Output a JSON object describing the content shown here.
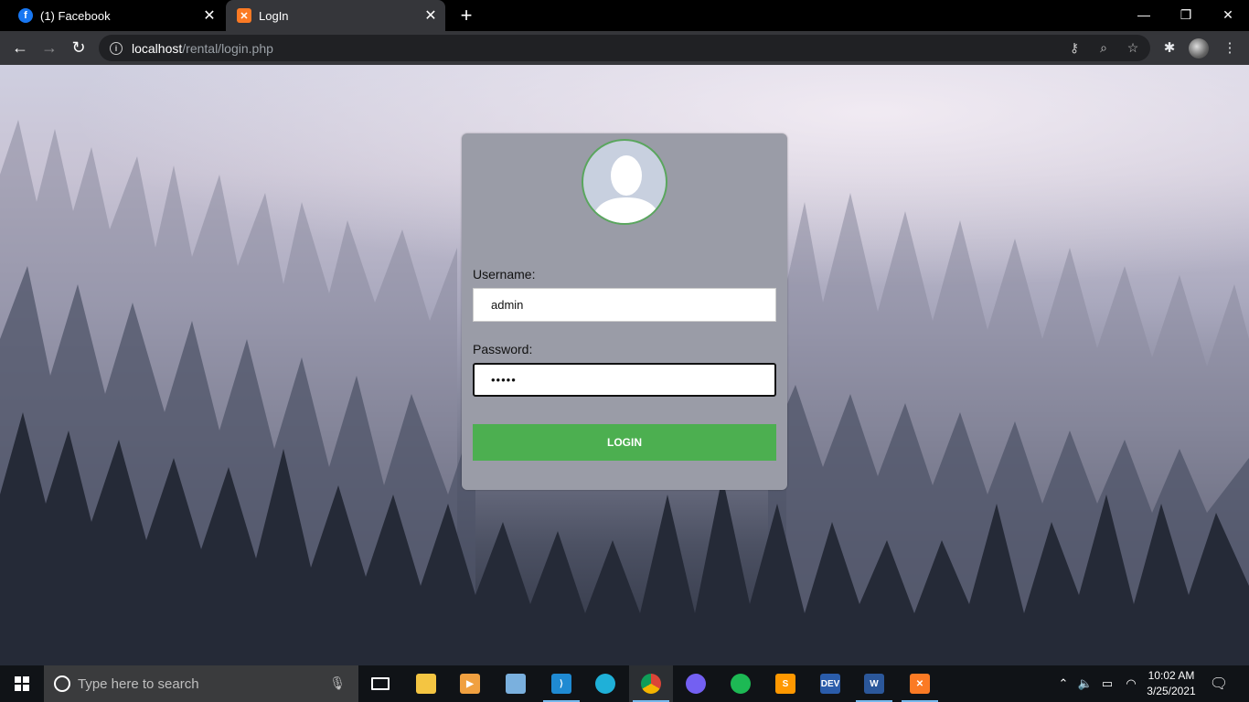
{
  "browser": {
    "tabs": [
      {
        "title": "(1) Facebook",
        "favicon": "facebook-icon",
        "active": false
      },
      {
        "title": "LogIn",
        "favicon": "xampp-icon",
        "active": true
      }
    ],
    "new_tab": "+",
    "url_host": "localhost",
    "url_path": "/rental/login.php"
  },
  "login": {
    "username_label": "Username:",
    "username_value": "admin",
    "password_label": "Password:",
    "password_value": "•••••",
    "button_label": "LOGIN"
  },
  "taskbar": {
    "search_placeholder": "Type here to search",
    "apps": [
      "file-explorer",
      "media-player",
      "virtualbox",
      "vscode",
      "edge",
      "chrome",
      "viber",
      "spotify",
      "sublime-text",
      "dev-cpp",
      "word",
      "xampp"
    ],
    "time": "10:02 AM",
    "date": "3/25/2021"
  },
  "colors": {
    "login_button": "#4caf50",
    "card": "#9a9ca7",
    "avatar_border": "#5aa65e"
  }
}
